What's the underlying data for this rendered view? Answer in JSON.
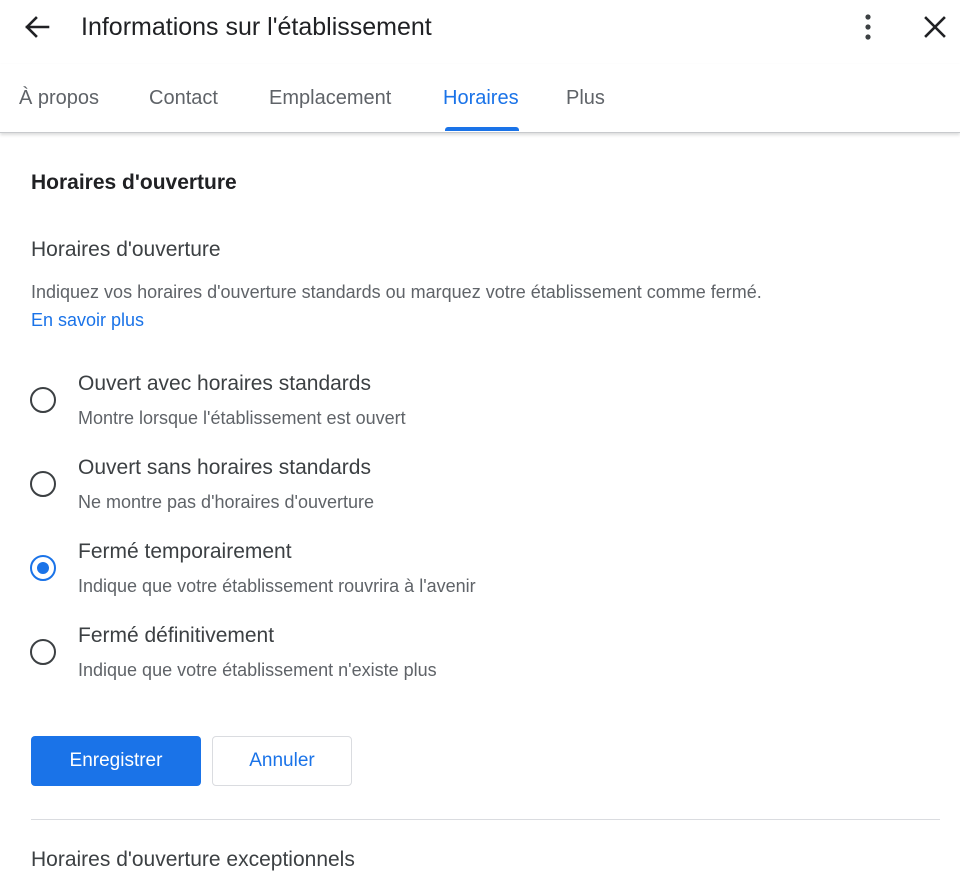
{
  "header": {
    "title": "Informations sur l'établissement",
    "back_icon": "arrow-back-icon",
    "more_icon": "more-vert-icon",
    "close_icon": "close-icon"
  },
  "tabs": [
    {
      "label": "À propos",
      "active": false
    },
    {
      "label": "Contact",
      "active": false
    },
    {
      "label": "Emplacement",
      "active": false
    },
    {
      "label": "Horaires",
      "active": true
    },
    {
      "label": "Plus",
      "active": false
    }
  ],
  "section": {
    "title": "Horaires d'ouverture",
    "subtitle": "Horaires d'ouverture",
    "description": "Indiquez vos horaires d'ouverture standards ou marquez votre établissement comme fermé.",
    "learn_more": "En savoir plus"
  },
  "options": [
    {
      "label": "Ouvert avec horaires standards",
      "description": "Montre lorsque l'établissement est ouvert",
      "selected": false
    },
    {
      "label": "Ouvert sans horaires standards",
      "description": "Ne montre pas d'horaires d'ouverture",
      "selected": false
    },
    {
      "label": "Fermé temporairement",
      "description": "Indique que votre établissement rouvrira à l'avenir",
      "selected": true
    },
    {
      "label": "Fermé définitivement",
      "description": "Indique que votre établissement n'existe plus",
      "selected": false
    }
  ],
  "actions": {
    "save_label": "Enregistrer",
    "cancel_label": "Annuler"
  },
  "next_section": {
    "title": "Horaires d'ouverture exceptionnels"
  },
  "colors": {
    "accent": "#1a73e8",
    "text_primary": "#202124",
    "text_secondary": "#5f6368"
  }
}
